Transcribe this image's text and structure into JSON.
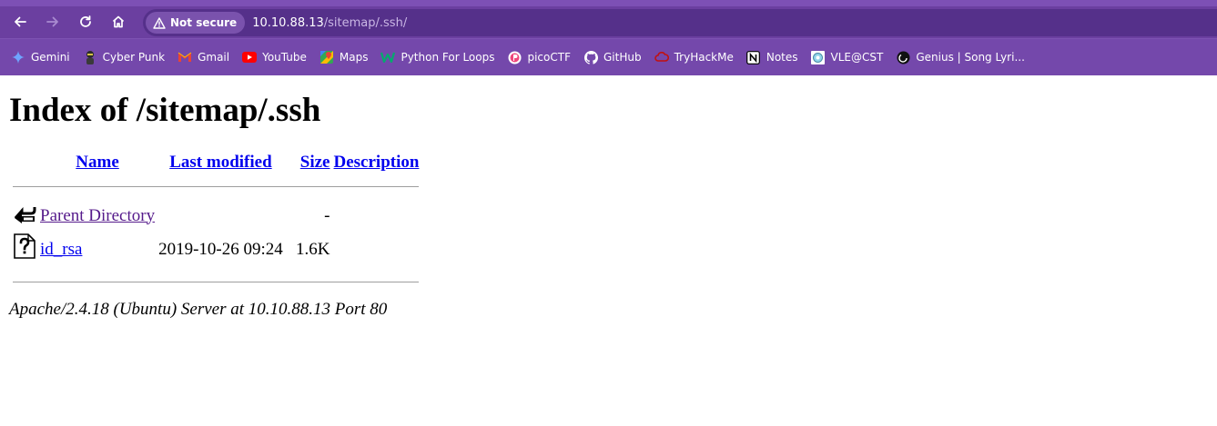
{
  "browser": {
    "security_label": "Not secure",
    "url_host": "10.10.88.13",
    "url_path": "/sitemap/.ssh/",
    "bookmarks": [
      {
        "label": "Gemini",
        "icon": "gemini-icon",
        "color": "#4a8cff"
      },
      {
        "label": "Cyber Punk",
        "icon": "cyberpunk-icon",
        "color": "#d4c244"
      },
      {
        "label": "Gmail",
        "icon": "gmail-icon",
        "color": "#ea4335"
      },
      {
        "label": "YouTube",
        "icon": "youtube-icon",
        "color": "#ff0000"
      },
      {
        "label": "Maps",
        "icon": "maps-icon",
        "color": "#34a853"
      },
      {
        "label": "Python For Loops",
        "icon": "w3-icon",
        "color": "#04aa6d"
      },
      {
        "label": "picoCTF",
        "icon": "picoctf-icon",
        "color": "#f0467c"
      },
      {
        "label": "GitHub",
        "icon": "github-icon",
        "color": "#ffffff"
      },
      {
        "label": "TryHackMe",
        "icon": "tryhackme-icon",
        "color": "#c11111"
      },
      {
        "label": "Notes",
        "icon": "notion-icon",
        "color": "#ffffff"
      },
      {
        "label": "VLE@CST",
        "icon": "vle-icon",
        "color": "#8fd3e8"
      },
      {
        "label": "Genius | Song Lyri...",
        "icon": "genius-icon",
        "color": "#ffff64"
      }
    ]
  },
  "page": {
    "title": "Index of /sitemap/.ssh",
    "columns": {
      "name": "Name",
      "last_modified": "Last modified",
      "size": "Size",
      "description": "Description"
    },
    "parent": {
      "name": "Parent Directory",
      "size": "-"
    },
    "files": [
      {
        "name": "id_rsa",
        "modified": "2019-10-26 09:24",
        "size": "1.6K",
        "description": ""
      }
    ],
    "server_signature": "Apache/2.4.18 (Ubuntu) Server at 10.10.88.13 Port 80"
  }
}
